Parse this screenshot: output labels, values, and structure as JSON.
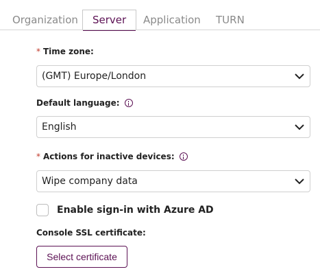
{
  "tabs": [
    {
      "label": "Organization",
      "active": false
    },
    {
      "label": "Server",
      "active": true
    },
    {
      "label": "Application",
      "active": false
    },
    {
      "label": "TURN",
      "active": false
    }
  ],
  "form": {
    "timezone": {
      "required_mark": "*",
      "label": "Time zone:",
      "value": "(GMT) Europe/London"
    },
    "language": {
      "label": "Default language:",
      "value": "English"
    },
    "inactive": {
      "required_mark": "*",
      "label": "Actions for inactive devices:",
      "value": "Wipe company data"
    },
    "azure": {
      "label": "Enable sign-in with Azure AD",
      "checked": false
    },
    "ssl": {
      "label": "Console SSL certificate:",
      "button_label": "Select certificate"
    }
  },
  "colors": {
    "accent": "#5b1053",
    "required": "#c0392b"
  }
}
